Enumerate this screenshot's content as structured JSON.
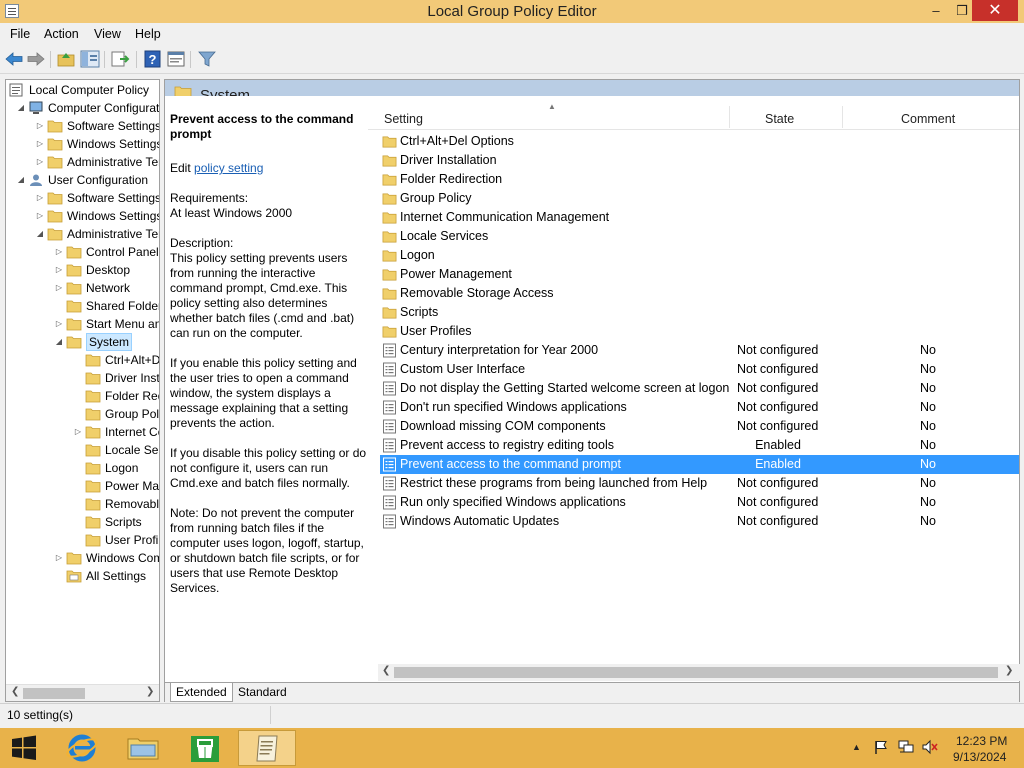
{
  "window": {
    "title": "Local Group Policy Editor",
    "min": "–",
    "max": "❒",
    "close": "✕"
  },
  "menu": {
    "items": [
      "File",
      "Action",
      "View",
      "Help"
    ]
  },
  "tree": {
    "items": [
      {
        "label": "Local Computer Policy",
        "level": 0,
        "exp": "",
        "icon": "computer-policy-icon"
      },
      {
        "label": "Computer Configuration",
        "level": 1,
        "exp": "◢",
        "icon": "computer-icon"
      },
      {
        "label": "Software Settings",
        "level": 2,
        "exp": "▷",
        "icon": "folder-icon"
      },
      {
        "label": "Windows Settings",
        "level": 2,
        "exp": "▷",
        "icon": "folder-icon"
      },
      {
        "label": "Administrative Templates",
        "level": 2,
        "exp": "▷",
        "icon": "folder-icon"
      },
      {
        "label": "User Configuration",
        "level": 1,
        "exp": "◢",
        "icon": "user-icon"
      },
      {
        "label": "Software Settings",
        "level": 2,
        "exp": "▷",
        "icon": "folder-icon"
      },
      {
        "label": "Windows Settings",
        "level": 2,
        "exp": "▷",
        "icon": "folder-icon"
      },
      {
        "label": "Administrative Templates",
        "level": 2,
        "exp": "◢",
        "icon": "folder-icon"
      },
      {
        "label": "Control Panel",
        "level": 3,
        "exp": "▷",
        "icon": "folder-icon"
      },
      {
        "label": "Desktop",
        "level": 3,
        "exp": "▷",
        "icon": "folder-icon"
      },
      {
        "label": "Network",
        "level": 3,
        "exp": "▷",
        "icon": "folder-icon"
      },
      {
        "label": "Shared Folders",
        "level": 3,
        "exp": "",
        "icon": "folder-icon"
      },
      {
        "label": "Start Menu and Taskbar",
        "level": 3,
        "exp": "▷",
        "icon": "folder-icon"
      },
      {
        "label": "System",
        "level": 3,
        "exp": "◢",
        "icon": "folder-open-icon",
        "selected": true
      },
      {
        "label": "Ctrl+Alt+Del Options",
        "level": 4,
        "exp": "",
        "icon": "folder-icon"
      },
      {
        "label": "Driver Installation",
        "level": 4,
        "exp": "",
        "icon": "folder-icon"
      },
      {
        "label": "Folder Redirection",
        "level": 4,
        "exp": "",
        "icon": "folder-icon"
      },
      {
        "label": "Group Policy",
        "level": 4,
        "exp": "",
        "icon": "folder-icon"
      },
      {
        "label": "Internet Communication Management",
        "level": 4,
        "exp": "▷",
        "icon": "folder-icon"
      },
      {
        "label": "Locale Services",
        "level": 4,
        "exp": "",
        "icon": "folder-icon"
      },
      {
        "label": "Logon",
        "level": 4,
        "exp": "",
        "icon": "folder-icon"
      },
      {
        "label": "Power Management",
        "level": 4,
        "exp": "",
        "icon": "folder-icon"
      },
      {
        "label": "Removable Storage Access",
        "level": 4,
        "exp": "",
        "icon": "folder-icon"
      },
      {
        "label": "Scripts",
        "level": 4,
        "exp": "",
        "icon": "folder-icon"
      },
      {
        "label": "User Profiles",
        "level": 4,
        "exp": "",
        "icon": "folder-icon"
      },
      {
        "label": "Windows Components",
        "level": 3,
        "exp": "▷",
        "icon": "folder-icon"
      },
      {
        "label": "All Settings",
        "level": 3,
        "exp": "",
        "icon": "all-settings-icon"
      }
    ]
  },
  "header": {
    "title": "System"
  },
  "description": {
    "title": "Prevent access to the command prompt",
    "edit_prefix": "Edit",
    "edit_link": "policy setting",
    "requirements": "Requirements:\nAt least Windows 2000",
    "description": "Description:\nThis policy setting prevents users\nfrom running the interactive\ncommand prompt, Cmd.exe.  This\npolicy setting also determines\nwhether batch files (.cmd and .bat)\ncan run on the computer.",
    "enable": "If you enable this policy setting and\nthe user tries to open a command\nwindow, the system displays a\nmessage explaining that a setting\nprevents the action.",
    "disable": "If you disable this policy setting or do\nnot configure it, users can run\nCmd.exe and batch files normally.",
    "note": "Note: Do not prevent the computer\nfrom running batch files if the\ncomputer uses logon, logoff, startup,\nor shutdown batch file scripts, or for\nusers that use Remote Desktop\nServices."
  },
  "list": {
    "columns": {
      "setting": "Setting",
      "state": "State",
      "comment": "Comment"
    },
    "folders": [
      "Ctrl+Alt+Del Options",
      "Driver Installation",
      "Folder Redirection",
      "Group Policy",
      "Internet Communication Management",
      "Locale Services",
      "Logon",
      "Power Management",
      "Removable Storage Access",
      "Scripts",
      "User Profiles"
    ],
    "policies": [
      {
        "name": "Century interpretation for Year 2000",
        "state": "Not configured",
        "comment": "No"
      },
      {
        "name": "Custom User Interface",
        "state": "Not configured",
        "comment": "No"
      },
      {
        "name": "Do not display the Getting Started welcome screen at logon",
        "state": "Not configured",
        "comment": "No"
      },
      {
        "name": "Don't run specified Windows applications",
        "state": "Not configured",
        "comment": "No"
      },
      {
        "name": "Download missing COM components",
        "state": "Not configured",
        "comment": "No"
      },
      {
        "name": "Prevent access to registry editing tools",
        "state": "Enabled",
        "comment": "No"
      },
      {
        "name": "Prevent access to the command prompt",
        "state": "Enabled",
        "comment": "No",
        "selected": true
      },
      {
        "name": "Restrict these programs from being launched from Help",
        "state": "Not configured",
        "comment": "No"
      },
      {
        "name": "Run only specified Windows applications",
        "state": "Not configured",
        "comment": "No"
      },
      {
        "name": "Windows Automatic Updates",
        "state": "Not configured",
        "comment": "No"
      }
    ]
  },
  "tabs": {
    "extended": "Extended",
    "standard": "Standard"
  },
  "status": {
    "text": "10 setting(s)"
  },
  "clock": {
    "time": "12:23 PM",
    "date": "9/13/2024"
  },
  "colors": {
    "selection": "#3399ff",
    "titlebar": "#f2c978",
    "taskbar": "#e8b24a"
  }
}
